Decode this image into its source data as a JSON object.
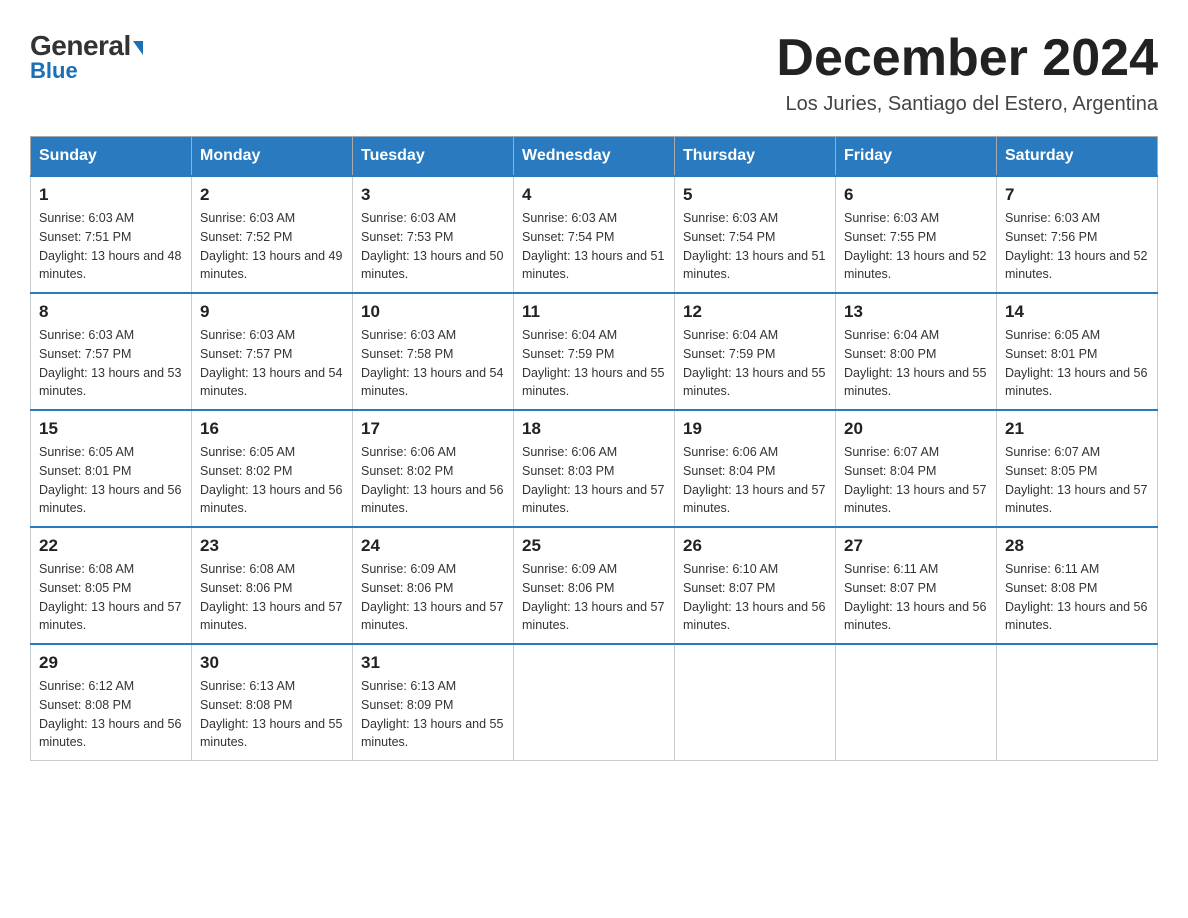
{
  "header": {
    "logo_general": "General",
    "logo_blue": "Blue",
    "month_title": "December 2024",
    "location": "Los Juries, Santiago del Estero, Argentina"
  },
  "weekdays": [
    "Sunday",
    "Monday",
    "Tuesday",
    "Wednesday",
    "Thursday",
    "Friday",
    "Saturday"
  ],
  "weeks": [
    [
      {
        "day": "1",
        "sunrise": "6:03 AM",
        "sunset": "7:51 PM",
        "daylight": "13 hours and 48 minutes."
      },
      {
        "day": "2",
        "sunrise": "6:03 AM",
        "sunset": "7:52 PM",
        "daylight": "13 hours and 49 minutes."
      },
      {
        "day": "3",
        "sunrise": "6:03 AM",
        "sunset": "7:53 PM",
        "daylight": "13 hours and 50 minutes."
      },
      {
        "day": "4",
        "sunrise": "6:03 AM",
        "sunset": "7:54 PM",
        "daylight": "13 hours and 51 minutes."
      },
      {
        "day": "5",
        "sunrise": "6:03 AM",
        "sunset": "7:54 PM",
        "daylight": "13 hours and 51 minutes."
      },
      {
        "day": "6",
        "sunrise": "6:03 AM",
        "sunset": "7:55 PM",
        "daylight": "13 hours and 52 minutes."
      },
      {
        "day": "7",
        "sunrise": "6:03 AM",
        "sunset": "7:56 PM",
        "daylight": "13 hours and 52 minutes."
      }
    ],
    [
      {
        "day": "8",
        "sunrise": "6:03 AM",
        "sunset": "7:57 PM",
        "daylight": "13 hours and 53 minutes."
      },
      {
        "day": "9",
        "sunrise": "6:03 AM",
        "sunset": "7:57 PM",
        "daylight": "13 hours and 54 minutes."
      },
      {
        "day": "10",
        "sunrise": "6:03 AM",
        "sunset": "7:58 PM",
        "daylight": "13 hours and 54 minutes."
      },
      {
        "day": "11",
        "sunrise": "6:04 AM",
        "sunset": "7:59 PM",
        "daylight": "13 hours and 55 minutes."
      },
      {
        "day": "12",
        "sunrise": "6:04 AM",
        "sunset": "7:59 PM",
        "daylight": "13 hours and 55 minutes."
      },
      {
        "day": "13",
        "sunrise": "6:04 AM",
        "sunset": "8:00 PM",
        "daylight": "13 hours and 55 minutes."
      },
      {
        "day": "14",
        "sunrise": "6:05 AM",
        "sunset": "8:01 PM",
        "daylight": "13 hours and 56 minutes."
      }
    ],
    [
      {
        "day": "15",
        "sunrise": "6:05 AM",
        "sunset": "8:01 PM",
        "daylight": "13 hours and 56 minutes."
      },
      {
        "day": "16",
        "sunrise": "6:05 AM",
        "sunset": "8:02 PM",
        "daylight": "13 hours and 56 minutes."
      },
      {
        "day": "17",
        "sunrise": "6:06 AM",
        "sunset": "8:02 PM",
        "daylight": "13 hours and 56 minutes."
      },
      {
        "day": "18",
        "sunrise": "6:06 AM",
        "sunset": "8:03 PM",
        "daylight": "13 hours and 57 minutes."
      },
      {
        "day": "19",
        "sunrise": "6:06 AM",
        "sunset": "8:04 PM",
        "daylight": "13 hours and 57 minutes."
      },
      {
        "day": "20",
        "sunrise": "6:07 AM",
        "sunset": "8:04 PM",
        "daylight": "13 hours and 57 minutes."
      },
      {
        "day": "21",
        "sunrise": "6:07 AM",
        "sunset": "8:05 PM",
        "daylight": "13 hours and 57 minutes."
      }
    ],
    [
      {
        "day": "22",
        "sunrise": "6:08 AM",
        "sunset": "8:05 PM",
        "daylight": "13 hours and 57 minutes."
      },
      {
        "day": "23",
        "sunrise": "6:08 AM",
        "sunset": "8:06 PM",
        "daylight": "13 hours and 57 minutes."
      },
      {
        "day": "24",
        "sunrise": "6:09 AM",
        "sunset": "8:06 PM",
        "daylight": "13 hours and 57 minutes."
      },
      {
        "day": "25",
        "sunrise": "6:09 AM",
        "sunset": "8:06 PM",
        "daylight": "13 hours and 57 minutes."
      },
      {
        "day": "26",
        "sunrise": "6:10 AM",
        "sunset": "8:07 PM",
        "daylight": "13 hours and 56 minutes."
      },
      {
        "day": "27",
        "sunrise": "6:11 AM",
        "sunset": "8:07 PM",
        "daylight": "13 hours and 56 minutes."
      },
      {
        "day": "28",
        "sunrise": "6:11 AM",
        "sunset": "8:08 PM",
        "daylight": "13 hours and 56 minutes."
      }
    ],
    [
      {
        "day": "29",
        "sunrise": "6:12 AM",
        "sunset": "8:08 PM",
        "daylight": "13 hours and 56 minutes."
      },
      {
        "day": "30",
        "sunrise": "6:13 AM",
        "sunset": "8:08 PM",
        "daylight": "13 hours and 55 minutes."
      },
      {
        "day": "31",
        "sunrise": "6:13 AM",
        "sunset": "8:09 PM",
        "daylight": "13 hours and 55 minutes."
      },
      null,
      null,
      null,
      null
    ]
  ]
}
